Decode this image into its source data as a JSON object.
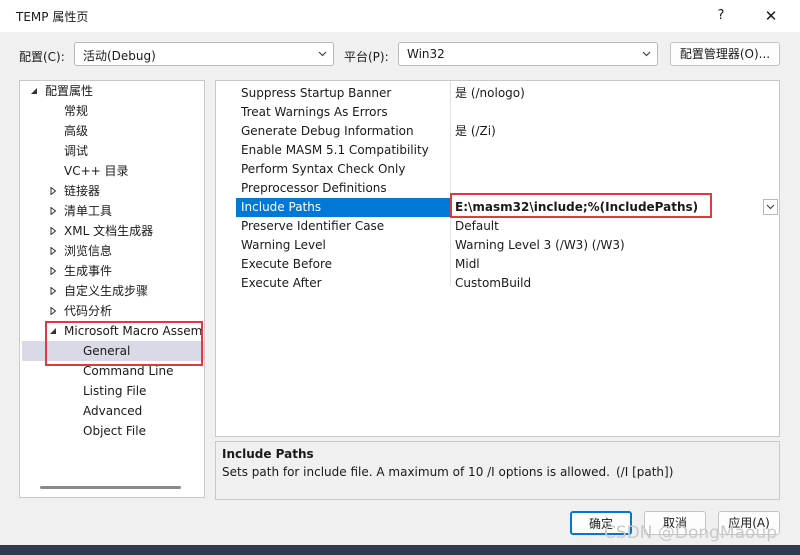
{
  "window": {
    "title": "TEMP 属性页",
    "help_glyph": "?",
    "close_glyph": "✕"
  },
  "toolbar": {
    "config_label": "配置(C):",
    "config_value": "活动(Debug)",
    "platform_label": "平台(P):",
    "platform_value": "Win32",
    "config_manager_label": "配置管理器(O)..."
  },
  "tree": {
    "root": "配置属性",
    "items": [
      "常规",
      "高级",
      "调试",
      "VC++ 目录",
      "链接器",
      "清单工具",
      "XML 文档生成器",
      "浏览信息",
      "生成事件",
      "自定义生成步骤",
      "代码分析"
    ],
    "masm": "Microsoft Macro Assem",
    "masm_children": [
      "General",
      "Command Line",
      "Listing File",
      "Advanced",
      "Object File"
    ]
  },
  "grid": {
    "rows": [
      {
        "name": "Suppress Startup Banner",
        "value": "是 (/nologo)"
      },
      {
        "name": "Treat Warnings As Errors",
        "value": ""
      },
      {
        "name": "Generate Debug Information",
        "value": "是 (/Zi)"
      },
      {
        "name": "Enable MASM 5.1 Compatibility",
        "value": ""
      },
      {
        "name": "Perform Syntax Check Only",
        "value": ""
      },
      {
        "name": "Preprocessor Definitions",
        "value": ""
      },
      {
        "name": "Include Paths",
        "value": "E:\\masm32\\include;%(IncludePaths)"
      },
      {
        "name": "Preserve Identifier Case",
        "value": "Default"
      },
      {
        "name": "Warning Level",
        "value": "Warning Level 3 (/W3) (/W3)"
      },
      {
        "name": "Execute Before",
        "value": "Midl"
      },
      {
        "name": "Execute After",
        "value": "CustomBuild"
      }
    ]
  },
  "description": {
    "title": "Include Paths",
    "text": "Sets path for include file. A maximum of 10 /I options is allowed.",
    "switch": "(/I [path])"
  },
  "buttons": {
    "ok": "确定",
    "cancel": "取消",
    "apply": "应用(A)"
  },
  "watermark": "CSDN @DongMaoup",
  "colors": {
    "accent": "#0078d7",
    "highlight_box": "#e03a3a",
    "selected_tree": "#d9d9e8"
  }
}
